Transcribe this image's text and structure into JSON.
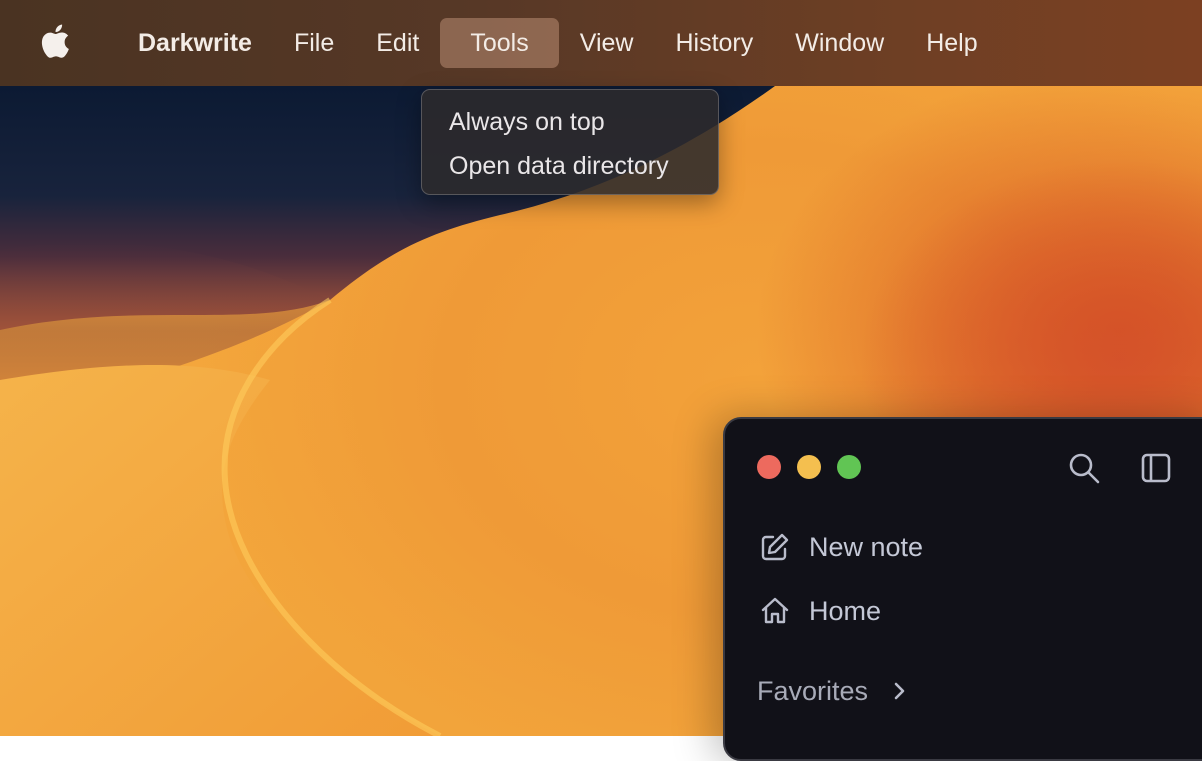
{
  "menubar": {
    "apple_icon": "apple-logo-icon",
    "app_name": "Darkwrite",
    "items": [
      {
        "label": "File"
      },
      {
        "label": "Edit"
      },
      {
        "label": "Tools",
        "active": true
      },
      {
        "label": "View"
      },
      {
        "label": "History"
      },
      {
        "label": "Window"
      },
      {
        "label": "Help"
      }
    ]
  },
  "tools_menu": {
    "items": [
      {
        "label": "Always on top"
      },
      {
        "label": "Open data directory"
      }
    ]
  },
  "window": {
    "traffic_lights": {
      "close_color": "#ed6a5e",
      "minimize_color": "#f4bf4f",
      "maximize_color": "#61c554"
    },
    "toolbar": {
      "search_icon": "search-icon",
      "sidebar_icon": "sidebar-toggle-icon"
    },
    "nav": {
      "new_note": {
        "label": "New note",
        "icon": "pencil-square-icon"
      },
      "home": {
        "label": "Home",
        "icon": "home-icon"
      }
    },
    "favorites": {
      "label": "Favorites",
      "icon": "chevron-right-icon"
    }
  },
  "colors": {
    "menubar_bg": "#573826",
    "window_bg": "#111118",
    "wallpaper_orange": "#f3a23a",
    "wallpaper_navy": "#0f1f38"
  }
}
